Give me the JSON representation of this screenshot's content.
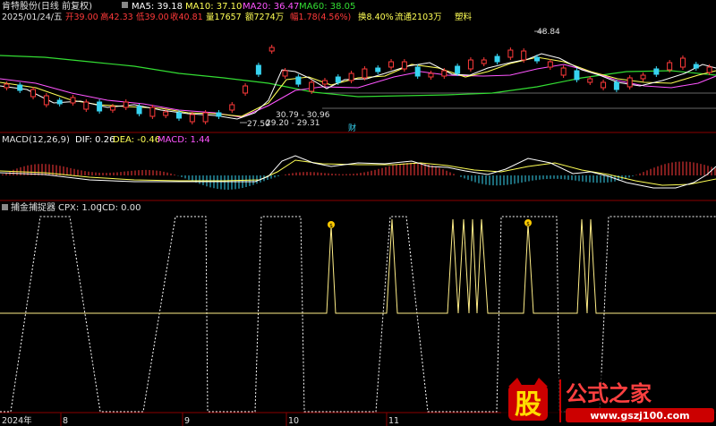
{
  "header": {
    "title": "肯特股份(日线 前复权)",
    "ma5": "MA5: 39.18",
    "ma10": "MA10: 37.10",
    "ma20": "MA20: 36.47",
    "ma60": "MA60: 38.05"
  },
  "quote": {
    "date": "2025/01/24/五",
    "open": "开39.00",
    "high": "高42.33",
    "low": "低39.00",
    "close": "收40.81",
    "volume": "量17657",
    "amount": "额7274万",
    "change": "幅1.78(4.56%)",
    "turnover": "换8.40%",
    "float": "流通2103万",
    "sector": "塑料"
  },
  "price_annotations": {
    "peak": "48.84",
    "low": "27.50",
    "range1": "30.79 - 30.96",
    "range2": "29.20 - 29.31",
    "finance_mark": "财"
  },
  "macd": {
    "title": "MACD(12,26,9)",
    "dif": "DIF: 0.26",
    "dea": "DEA: -0.46",
    "macd": "MACD: 1.44"
  },
  "indicator": {
    "name": "捕金捕捉器",
    "cpx": "CPX: 1.00",
    "jcd": "JCD: 0.00"
  },
  "time_axis": {
    "labels": [
      "2024年",
      "8",
      "9",
      "10",
      "11"
    ]
  },
  "watermark": {
    "logo_text": "股",
    "brand": "公式之家",
    "url": "www.gszj100.com"
  },
  "colors": {
    "up": "#ff3a3a",
    "down": "#37d3f0",
    "ma5": "#ffffff",
    "ma10": "#ffff55",
    "ma20": "#ff55ff",
    "ma60": "#33dd33",
    "accent": "#ffcc00"
  }
}
